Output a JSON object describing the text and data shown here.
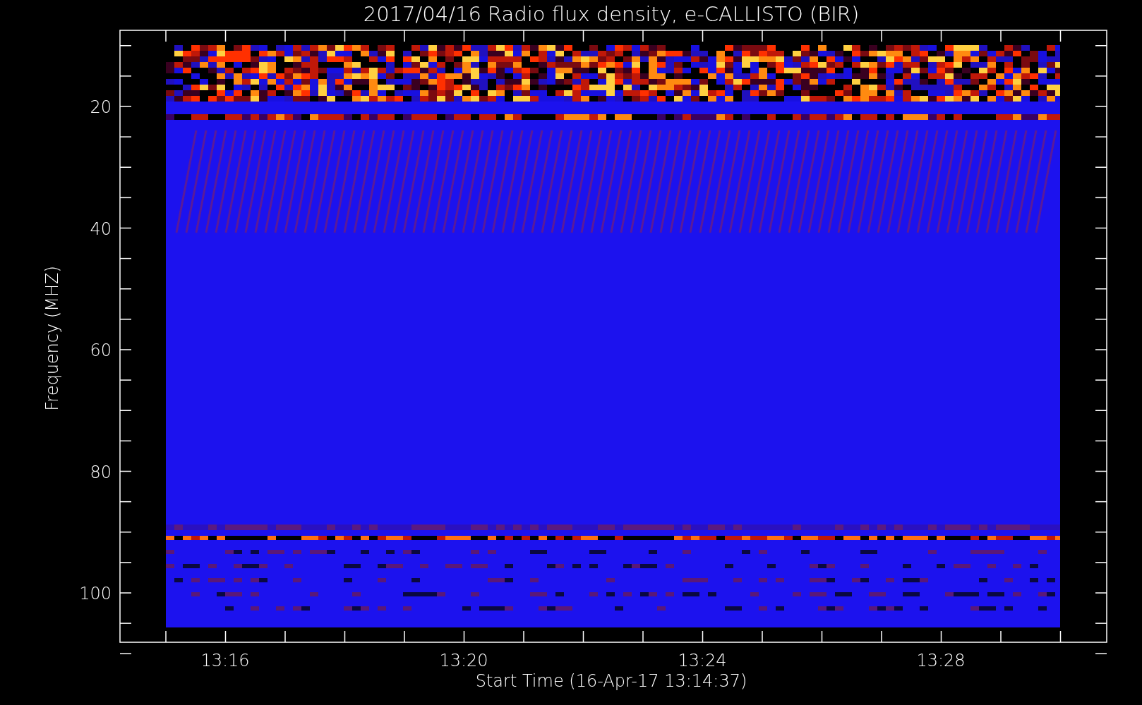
{
  "chart": {
    "title": "2017/04/16  Radio flux density, e-CALLISTO (BIR)",
    "ylabel": "Frequency (MHZ)",
    "yticks": [
      "20",
      "40",
      "60",
      "80",
      "100"
    ],
    "xlabel": "Start Time (16-Apr-17 13:14:37)",
    "xticks": [
      "13:16",
      "13:20",
      "13:24",
      "13:28"
    ]
  }
}
